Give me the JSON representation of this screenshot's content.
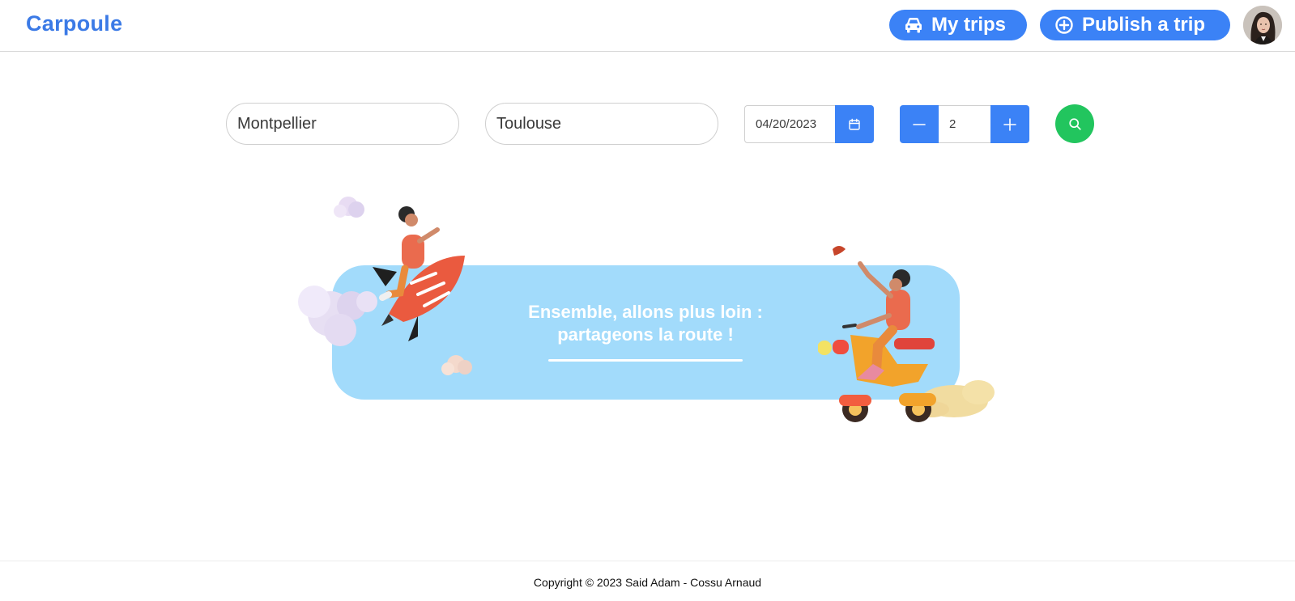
{
  "header": {
    "logo": "Carpoule",
    "my_trips_label": "My trips",
    "publish_label": "Publish a trip",
    "avatar_icon": "user-avatar-icon"
  },
  "search": {
    "from_value": "Montpellier",
    "to_value": "Toulouse",
    "date_value": "04/20/2023",
    "seats_value": "2",
    "calendar_icon": "calendar-icon",
    "minus_icon": "minus-icon",
    "plus_icon": "plus-icon",
    "search_icon": "search-icon"
  },
  "banner": {
    "line1": "Ensemble, allons plus loin :",
    "line2": "partageons la route !"
  },
  "footer": {
    "copyright": "Copyright © 2023 Said Adam - Cossu Arnaud"
  },
  "colors": {
    "brand": "#3b7ae6",
    "button": "#3b82f6",
    "search": "#22c55e",
    "banner": "#a2dbfb"
  }
}
